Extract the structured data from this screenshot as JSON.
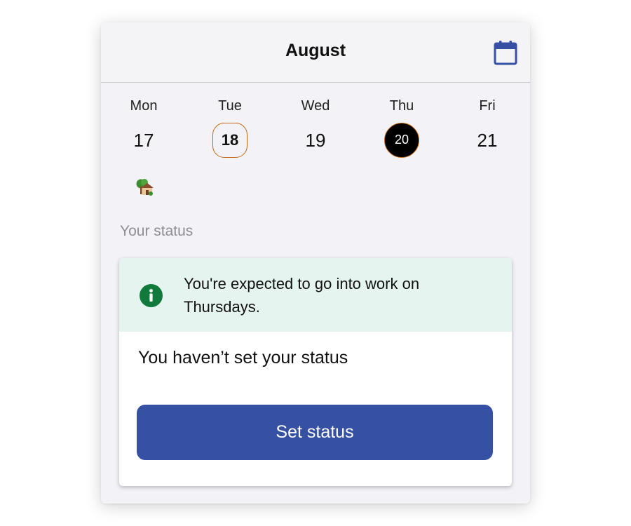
{
  "header": {
    "title": "August",
    "calendar_icon": "calendar-icon",
    "accent_color": "#3650a3"
  },
  "days": [
    {
      "name": "Mon",
      "number": "17",
      "state": "normal",
      "icon": "house-with-tree-icon"
    },
    {
      "name": "Tue",
      "number": "18",
      "state": "today"
    },
    {
      "name": "Wed",
      "number": "19",
      "state": "normal"
    },
    {
      "name": "Thu",
      "number": "20",
      "state": "selected"
    },
    {
      "name": "Fri",
      "number": "21",
      "state": "normal"
    }
  ],
  "status_section": {
    "label": "Your status",
    "info_banner": {
      "icon": "info-icon",
      "text": "You're expected to go into work on Thursdays.",
      "background_color": "#e5f4ee",
      "icon_color": "#0f7a3c"
    },
    "status_text": "You haven’t set your status",
    "button_label": "Set status",
    "button_color": "#3650a3"
  }
}
